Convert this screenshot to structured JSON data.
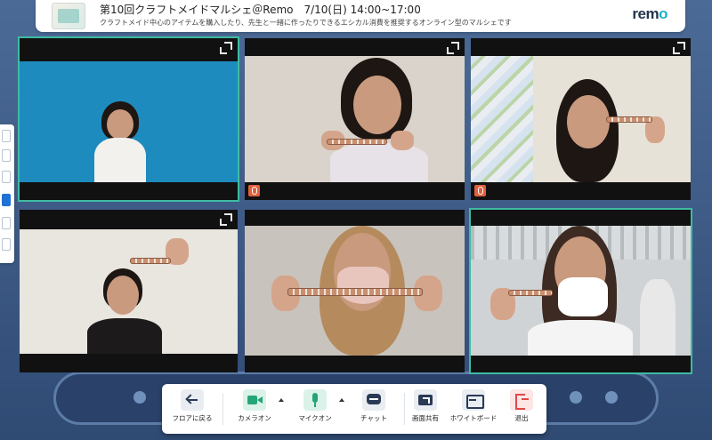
{
  "header": {
    "event_title": "第10回クラフトメイドマルシェ＠Remo　7/10(日) 14:00~17:00",
    "event_description": "クラフトメイド中心のアイテムを購入したり、先生と一緒に作ったりできるエシカル消費を推奨するオンライン型のマルシェです",
    "brand_prefix": "rem",
    "brand_suffix": "o"
  },
  "tiles": [
    {
      "id": "tile-1",
      "speaking": true,
      "muted": false,
      "background": "#1e8bbf"
    },
    {
      "id": "tile-2",
      "speaking": false,
      "muted": true,
      "background": "#d9d3cb"
    },
    {
      "id": "tile-3",
      "speaking": false,
      "muted": true,
      "background": "#e7e2d8"
    },
    {
      "id": "tile-4",
      "speaking": false,
      "muted": false,
      "background": "#e9e5df"
    },
    {
      "id": "tile-5",
      "speaking": false,
      "muted": false,
      "background": "#c9c3bd"
    },
    {
      "id": "tile-6",
      "speaking": true,
      "muted": false,
      "background": "#cfd3d5"
    }
  ],
  "toolbar": {
    "back_to_floor": "フロアに戻る",
    "camera_on": "カメラオン",
    "mic_on": "マイクオン",
    "chat": "チャット",
    "screen_share": "画面共有",
    "whiteboard": "ホワイトボード",
    "exit": "退出"
  },
  "colors": {
    "accent_green": "#22a577",
    "speaking_outline": "#3fbba3",
    "mute_red": "#e0603e",
    "exit_red": "#e04848",
    "brand_cyan": "#1ab2c7"
  }
}
